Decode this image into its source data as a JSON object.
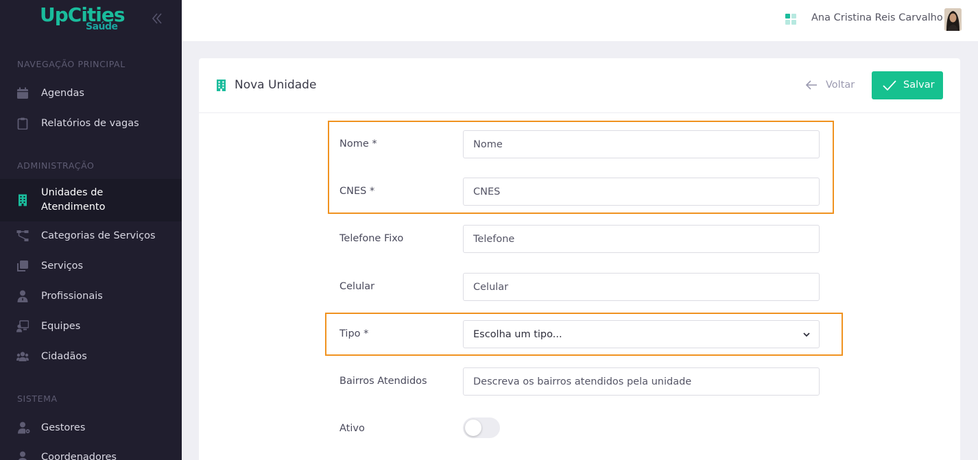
{
  "logo": {
    "main": "UpCities",
    "sub": "Saúde"
  },
  "sidebar": {
    "sections": {
      "main": "NAVEGAÇÃO PRINCIPAL",
      "admin": "ADMINISTRAÇÃO",
      "system": "SISTEMA"
    },
    "items": [
      {
        "label": "Agendas",
        "icon": "calendar-icon"
      },
      {
        "label": "Relatórios de vagas",
        "icon": "clipboard-icon"
      },
      {
        "label": "Unidades de Atendimento",
        "icon": "building-icon",
        "active": true
      },
      {
        "label": "Categorias de Serviços",
        "icon": "sitemap-icon"
      },
      {
        "label": "Serviços",
        "icon": "layers-icon"
      },
      {
        "label": "Profissionais",
        "icon": "user-tie-icon"
      },
      {
        "label": "Equipes",
        "icon": "chalkboard-user-icon"
      },
      {
        "label": "Cidadãos",
        "icon": "users-icon"
      },
      {
        "label": "Gestores",
        "icon": "user-cog-icon"
      },
      {
        "label": "Coordenadores",
        "icon": "user-icon"
      }
    ]
  },
  "topbar": {
    "user_name": "Ana Cristina Reis Carvalho"
  },
  "card": {
    "title": "Nova Unidade",
    "back_label": "Voltar",
    "save_label": "Salvar"
  },
  "form": {
    "nome": {
      "label": "Nome *",
      "placeholder": "Nome"
    },
    "cnes": {
      "label": "CNES *",
      "placeholder": "CNES"
    },
    "telefone": {
      "label": "Telefone Fixo",
      "placeholder": "Telefone"
    },
    "celular": {
      "label": "Celular",
      "placeholder": "Celular"
    },
    "tipo": {
      "label": "Tipo *",
      "value": "Escolha um tipo..."
    },
    "bairros": {
      "label": "Bairros Atendidos",
      "placeholder": "Descreva os bairros atendidos pela unidade"
    },
    "ativo": {
      "label": "Ativo",
      "checked": false
    }
  },
  "colors": {
    "accent": "#16c18f",
    "sidebar_bg": "#201e2e",
    "highlight": "#f0921f"
  }
}
